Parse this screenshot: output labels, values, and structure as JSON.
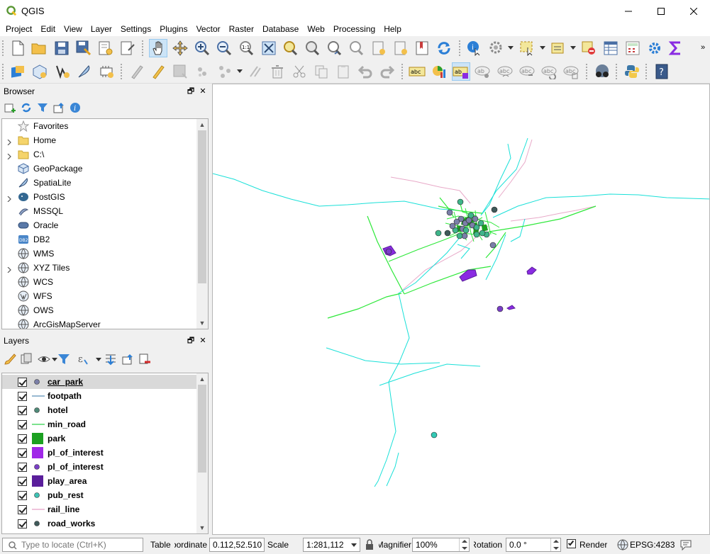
{
  "window": {
    "title": "QGIS"
  },
  "menu": [
    "Project",
    "Edit",
    "View",
    "Layer",
    "Settings",
    "Plugins",
    "Vector",
    "Raster",
    "Database",
    "Web",
    "Processing",
    "Help"
  ],
  "browser": {
    "title": "Browser",
    "items": [
      {
        "label": "Favorites",
        "icon": "star-icon",
        "expandable": false
      },
      {
        "label": "Home",
        "icon": "folder-icon",
        "expandable": true
      },
      {
        "label": "C:\\",
        "icon": "folder-icon",
        "expandable": true
      },
      {
        "label": "GeoPackage",
        "icon": "geopackage-icon",
        "expandable": false
      },
      {
        "label": "SpatiaLite",
        "icon": "spatialite-icon",
        "expandable": false
      },
      {
        "label": "PostGIS",
        "icon": "postgis-icon",
        "expandable": true
      },
      {
        "label": "MSSQL",
        "icon": "mssql-icon",
        "expandable": false
      },
      {
        "label": "Oracle",
        "icon": "oracle-icon",
        "expandable": false
      },
      {
        "label": "DB2",
        "icon": "db2-icon",
        "expandable": false
      },
      {
        "label": "WMS",
        "icon": "globe-icon",
        "expandable": false
      },
      {
        "label": "XYZ Tiles",
        "icon": "globe-icon",
        "expandable": true
      },
      {
        "label": "WCS",
        "icon": "globe-icon",
        "expandable": false
      },
      {
        "label": "WFS",
        "icon": "wfs-icon",
        "expandable": false
      },
      {
        "label": "OWS",
        "icon": "globe-icon",
        "expandable": false
      },
      {
        "label": "ArcGisMapServer",
        "icon": "globe-icon",
        "expandable": false
      }
    ]
  },
  "layers": {
    "title": "Layers",
    "items": [
      {
        "name": "car_park",
        "symbol": "point",
        "color": "#7b7fa8",
        "selected": true
      },
      {
        "name": "footpath",
        "symbol": "line",
        "color": "#5b8fb8",
        "selected": false
      },
      {
        "name": "hotel",
        "symbol": "point",
        "color": "#4f8a78",
        "selected": false
      },
      {
        "name": "min_road",
        "symbol": "line",
        "color": "#2ed14a",
        "selected": false
      },
      {
        "name": "park",
        "symbol": "fill",
        "color": "#1ca021",
        "selected": false
      },
      {
        "name": "pl_of_interest",
        "symbol": "fill",
        "color": "#a027e8",
        "selected": false
      },
      {
        "name": "pl_of_interest",
        "symbol": "point",
        "color": "#7a3fc7",
        "selected": false
      },
      {
        "name": "play_area",
        "symbol": "fill",
        "color": "#5a1e9b",
        "selected": false
      },
      {
        "name": "pub_rest",
        "symbol": "point",
        "color": "#3ec2b4",
        "selected": false
      },
      {
        "name": "rail_line",
        "symbol": "line",
        "color": "#e5a0c8",
        "selected": false
      },
      {
        "name": "road_works",
        "symbol": "point",
        "color": "#3f5a5a",
        "selected": false
      }
    ]
  },
  "status": {
    "locate_placeholder": "Type to locate (Ctrl+K)",
    "table_label": "Table",
    "coordinate_label": "Coordinate",
    "coordinate_value": "0.112,52.510",
    "scale_label": "Scale",
    "scale_value": "1:281,112",
    "magnifier_label": "Magnifier",
    "magnifier_value": "100%",
    "rotation_label": "Rotation",
    "rotation_value": "0.0 °",
    "render_label": "Render",
    "crs_label": "EPSG:4283"
  },
  "colors": {
    "footpath": "#19e0d8",
    "min_road": "#2ee83a",
    "rail_line": "#e8a9c8",
    "park": "#1ca021",
    "pl_of_interest": "#8a2be2",
    "pub_rest": "#33c9b5",
    "car_park": "#7b7fa8",
    "hotel": "#3fb58a"
  }
}
